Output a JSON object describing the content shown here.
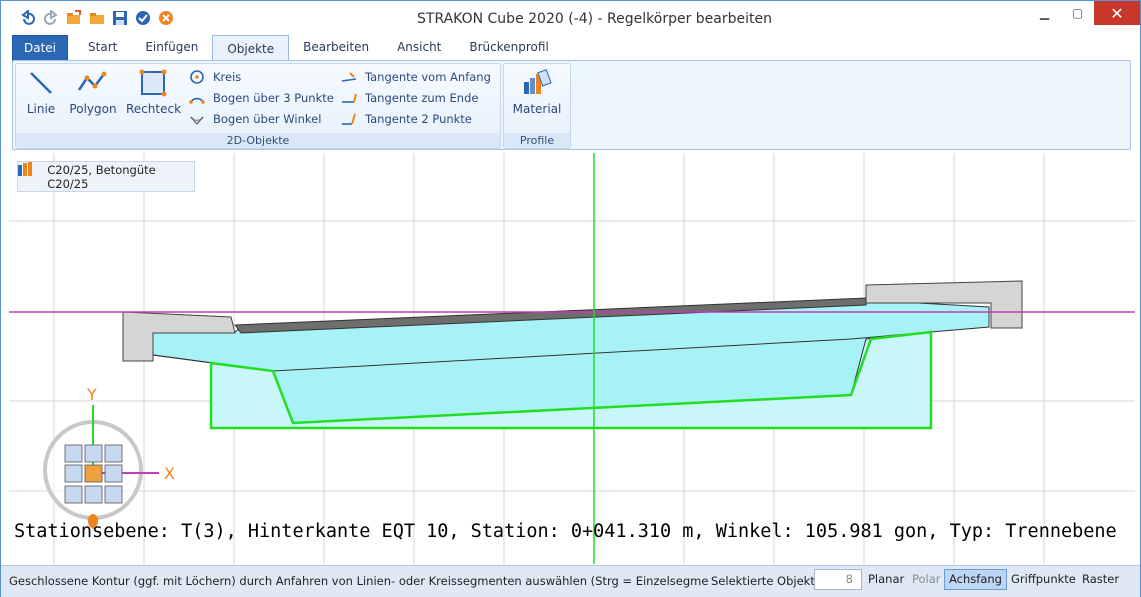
{
  "window": {
    "title": "STRAKON Cube 2020 (-4) - Regelkörper bearbeiten",
    "quick_access": [
      "undo-icon",
      "redo-icon",
      "open-folder-icon",
      "folder-icon",
      "save-icon",
      "ok-icon",
      "cancel-icon"
    ]
  },
  "tabs": [
    {
      "label": "Datei",
      "type": "file"
    },
    {
      "label": "Start"
    },
    {
      "label": "Einfügen"
    },
    {
      "label": "Objekte",
      "active": true
    },
    {
      "label": "Bearbeiten"
    },
    {
      "label": "Ansicht"
    },
    {
      "label": "Brückenprofil"
    }
  ],
  "ribbon": {
    "group_2d": {
      "label": "2D-Objekte",
      "big_buttons": [
        {
          "label": "Linie"
        },
        {
          "label": "Polygon"
        },
        {
          "label": "Rechteck"
        }
      ],
      "col1": [
        {
          "label": "Kreis"
        },
        {
          "label": "Bogen über 3 Punkte"
        },
        {
          "label": "Bogen über Winkel"
        }
      ],
      "col2": [
        {
          "label": "Tangente vom Anfang"
        },
        {
          "label": "Tangente zum Ende"
        },
        {
          "label": "Tangente 2 Punkte"
        }
      ]
    },
    "group_profile": {
      "label": "Profile",
      "button": "Material"
    }
  },
  "canvas": {
    "material_label": "C20/25, Betongüte C20/25",
    "axis_y": "Y",
    "axis_x": "X",
    "info_text": "Stationsebene: T(3), Hinterkante EQT 10,  Station: 0+041.310 m,  Winkel: 105.981 gon,  Typ: Trennebene"
  },
  "status": {
    "message": "Geschlossene Kontur (ggf. mit Löchern) durch Anfahren von Linien- oder Kreissegmenten auswählen (Strg = Einzelsegmente, Auswa",
    "selected_label": "Selektierte Objekte",
    "selected_count": "8",
    "toggles": [
      {
        "label": "Planar",
        "state": "normal"
      },
      {
        "label": "Polar",
        "state": "dim"
      },
      {
        "label": "Achsfang",
        "state": "on"
      },
      {
        "label": "Griffpunkte",
        "state": "normal"
      },
      {
        "label": "Raster",
        "state": "normal"
      }
    ]
  },
  "colors": {
    "accent": "#2a67b5",
    "green_contour": "#22dd22",
    "magenta_line": "#c23cb4",
    "fill_cyan": "#a6f2f6"
  }
}
